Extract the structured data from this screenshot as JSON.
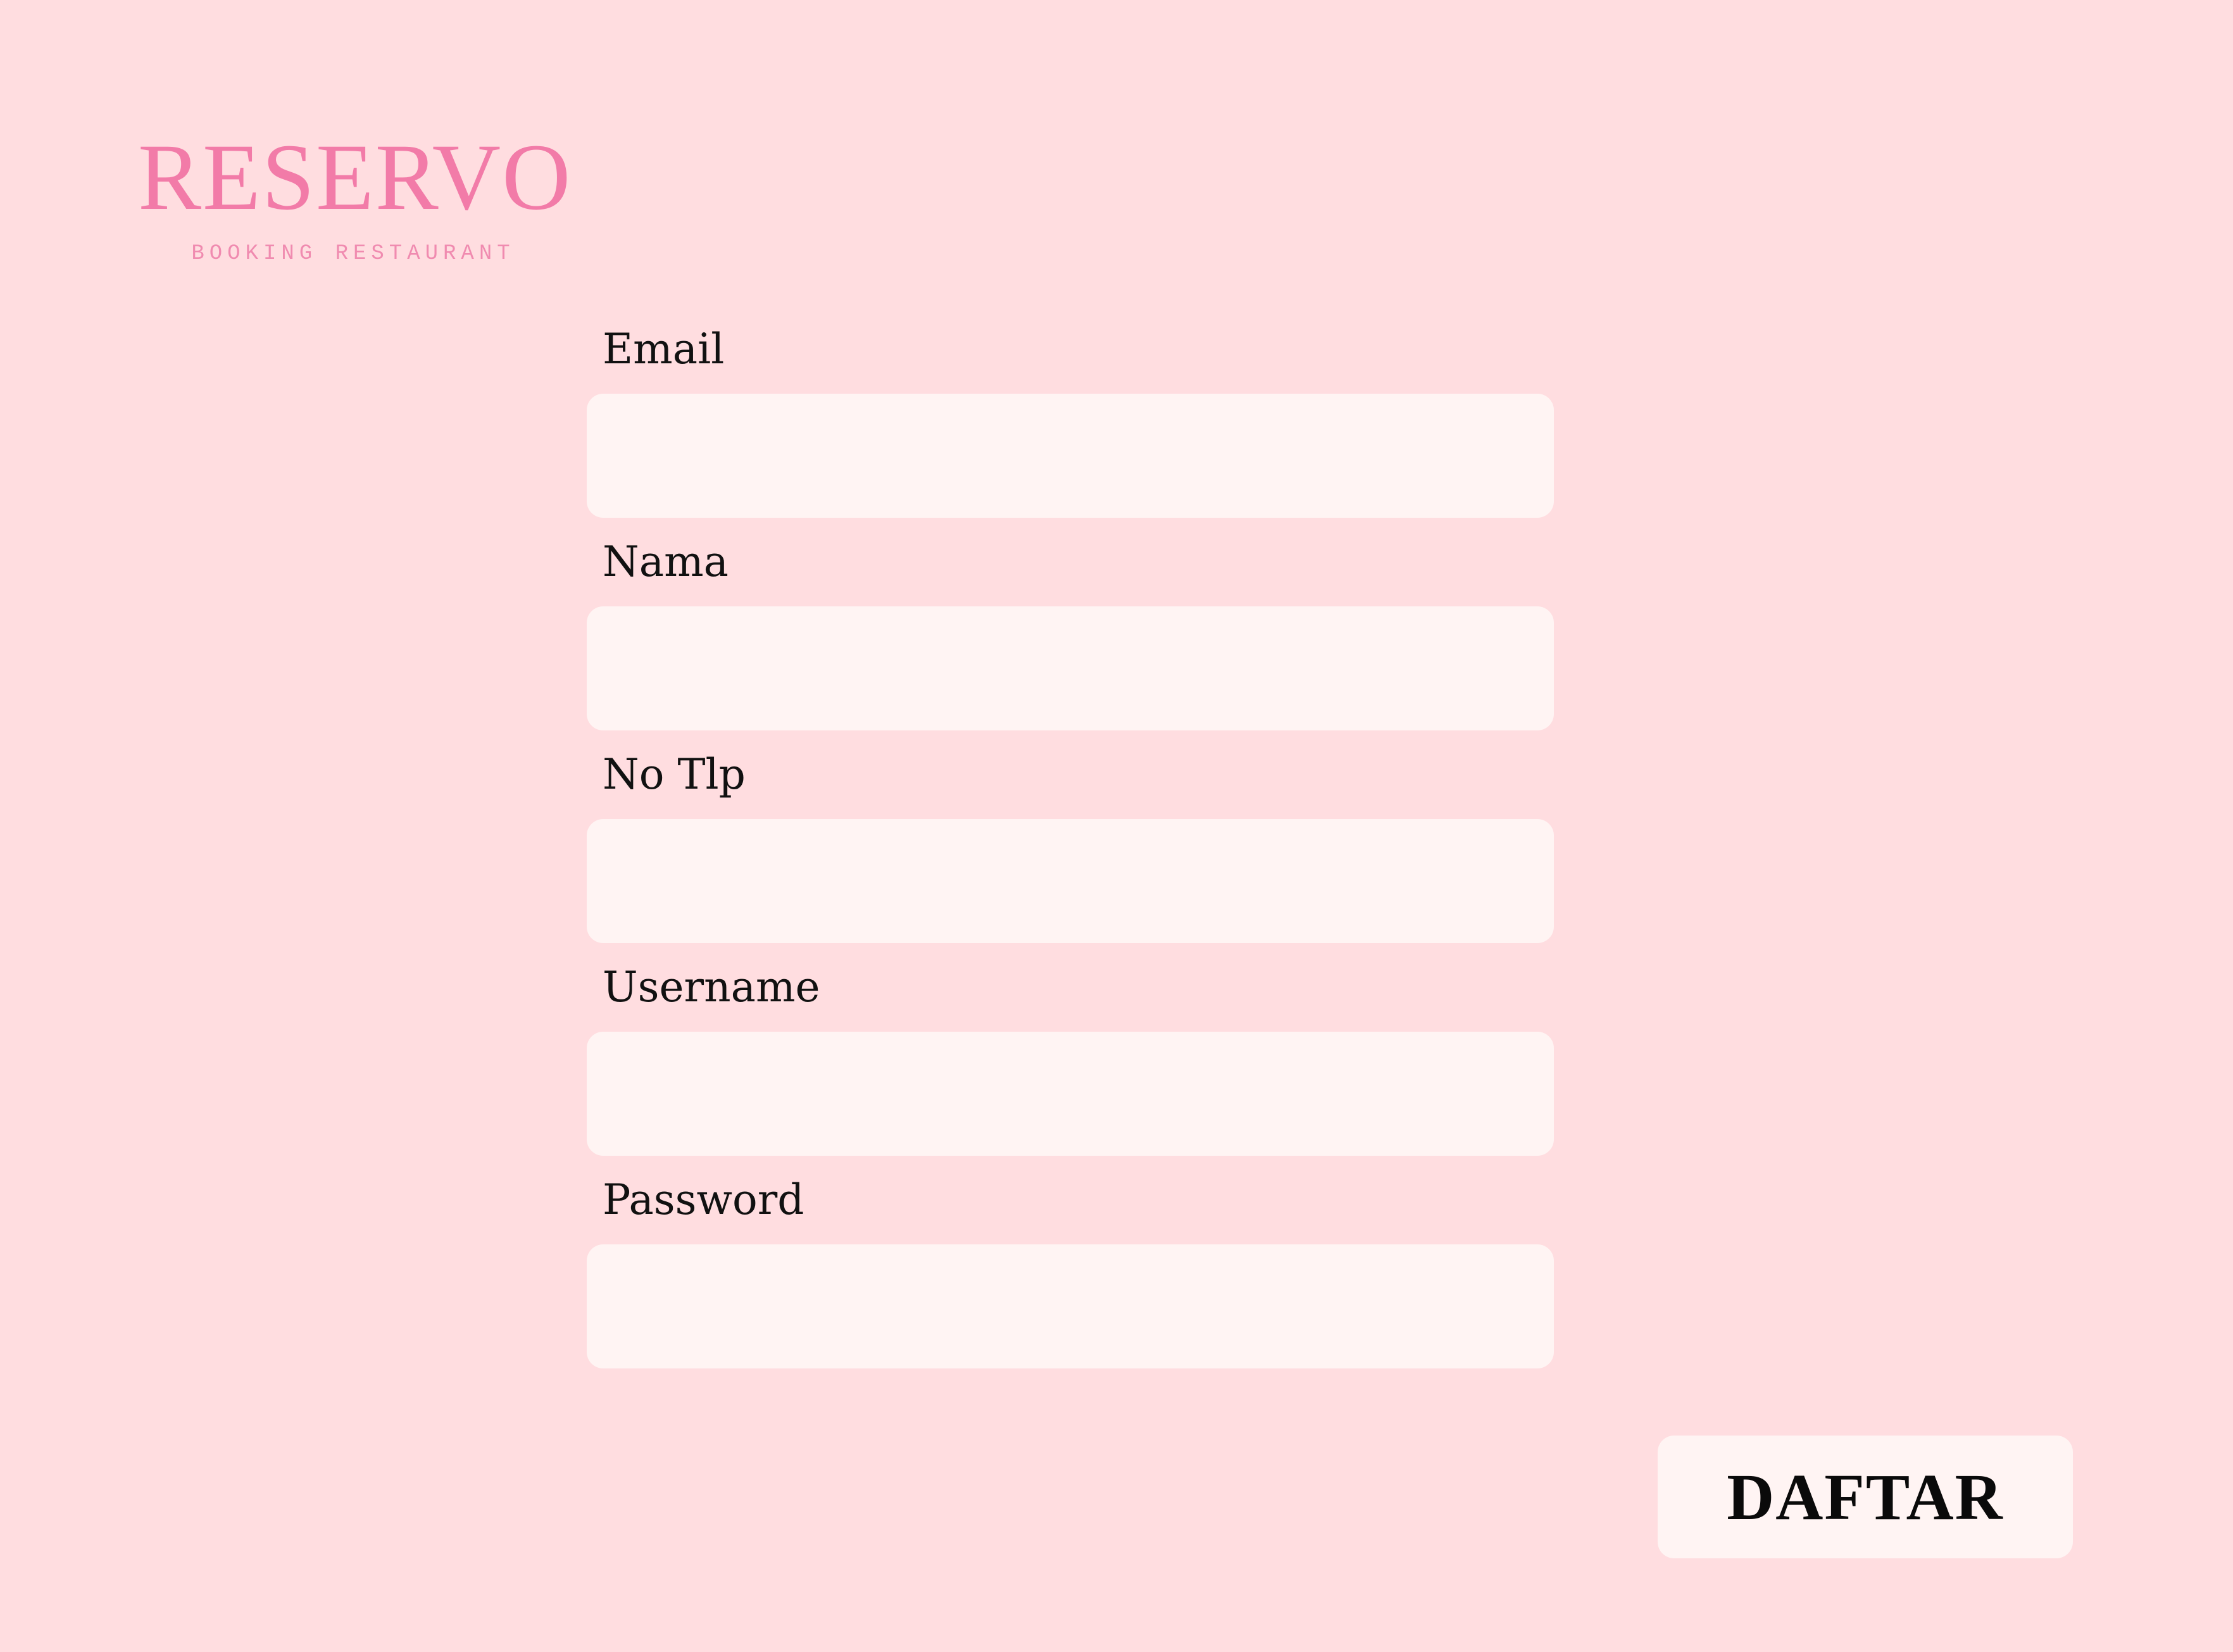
{
  "brand": {
    "title": "RESERVO",
    "subtitle": "BOOKING RESTAURANT",
    "color": "#F27BA8"
  },
  "form": {
    "fields": [
      {
        "label": "Email",
        "value": "",
        "placeholder": ""
      },
      {
        "label": "Nama",
        "value": "",
        "placeholder": ""
      },
      {
        "label": "No Tlp",
        "value": "",
        "placeholder": ""
      },
      {
        "label": "Username",
        "value": "",
        "placeholder": ""
      },
      {
        "label": "Password",
        "value": "",
        "placeholder": ""
      }
    ],
    "submit_label": "DAFTAR"
  },
  "colors": {
    "background": "#FFDDE0",
    "input_background": "#FFF4F3",
    "label_text": "#111111"
  }
}
